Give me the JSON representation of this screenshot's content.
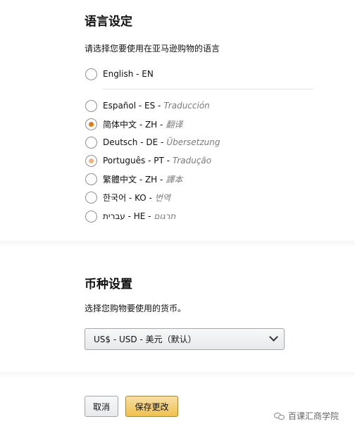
{
  "language": {
    "title": "语言设定",
    "description": "请选择您要使用在亚马逊购物的语言",
    "options": [
      {
        "label": "English - EN",
        "hint": "",
        "checked": false
      },
      {
        "label": "Español - ES -",
        "hint": "Traducción",
        "checked": false
      },
      {
        "label": "简体中文 - ZH -",
        "hint": "翻译",
        "checked": true
      },
      {
        "label": "Deutsch - DE -",
        "hint": "Übersetzung",
        "checked": false
      },
      {
        "label": "Português - PT -",
        "hint": "Tradução",
        "checked": false
      },
      {
        "label": "繁體中文 - ZH -",
        "hint": "譯本",
        "checked": false
      },
      {
        "label": "한국어 - KO -",
        "hint": "번역",
        "checked": false
      },
      {
        "label": "עברית - HE -",
        "hint": "תרגום",
        "checked": false
      }
    ]
  },
  "currency": {
    "title": "币种设置",
    "description": "选择您购物要使用的货币。",
    "selected": "US$ - USD - 美元（默认）"
  },
  "buttons": {
    "cancel": "取消",
    "save": "保存更改"
  },
  "watermark": "百课汇商学院",
  "colors": {
    "radio_accent": "#e47911",
    "save_button": "#f0c14b"
  }
}
